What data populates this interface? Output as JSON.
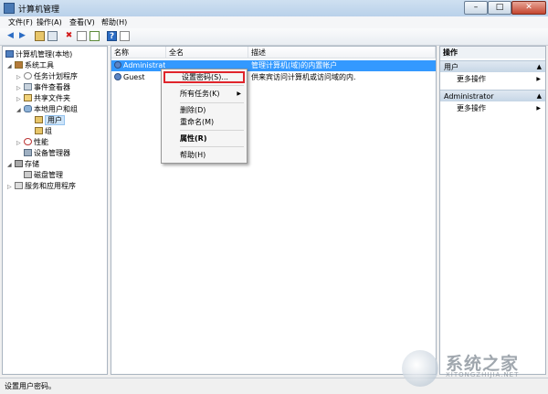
{
  "window": {
    "title": "计算机管理",
    "min": "–",
    "max": "□",
    "close": "✕"
  },
  "menu": [
    "文件(F)",
    "操作(A)",
    "查看(V)",
    "帮助(H)"
  ],
  "tree": {
    "root": "计算机管理(本地)",
    "system_tools": "系统工具",
    "task_scheduler": "任务计划程序",
    "event_viewer": "事件查看器",
    "shared_folders": "共享文件夹",
    "local_users_groups": "本地用户和组",
    "users": "用户",
    "groups": "组",
    "performance": "性能",
    "device_manager": "设备管理器",
    "storage": "存储",
    "disk_management": "磁盘管理",
    "services_apps": "服务和应用程序"
  },
  "list": {
    "columns": [
      "名称",
      "全名",
      "描述"
    ],
    "rows": [
      {
        "name": "Administrat...",
        "fullname": "",
        "desc": "管理计算机(域)的内置帐户"
      },
      {
        "name": "Guest",
        "fullname": "",
        "desc": "供来宾访问计算机或访问域的内..."
      }
    ]
  },
  "context_menu": {
    "set_password": "设置密码(S)...",
    "all_tasks": "所有任务(K)",
    "delete": "删除(D)",
    "rename": "重命名(M)",
    "properties": "属性(R)",
    "help": "帮助(H)"
  },
  "actions": {
    "title": "操作",
    "section1": "用户",
    "more1": "更多操作",
    "section2": "Administrator",
    "more2": "更多操作"
  },
  "status": "设置用户密码。",
  "watermark": {
    "text": "系统之家",
    "sub": "XITONGZHIJIA.NET"
  }
}
